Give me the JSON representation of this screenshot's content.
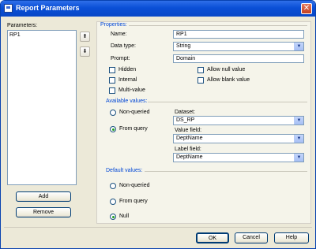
{
  "window": {
    "title": "Report Parameters",
    "close_glyph": "✕"
  },
  "parameters": {
    "label": "Parameters:",
    "items": [
      "RP1"
    ],
    "up_glyph": "⬆",
    "down_glyph": "⬇",
    "add_label": "Add",
    "remove_label": "Remove"
  },
  "properties": {
    "section_label": "Properties:",
    "name_label": "Name:",
    "name_value": "RP1",
    "datatype_label": "Data type:",
    "datatype_value": "String",
    "prompt_label": "Prompt:",
    "prompt_value": "Domain",
    "hidden_label": "Hidden",
    "internal_label": "Internal",
    "multivalue_label": "Multi-value",
    "allow_null_label": "Allow null value",
    "allow_blank_label": "Allow blank value"
  },
  "available_values": {
    "section_label": "Available values:",
    "nonqueried_label": "Non-queried",
    "fromquery_label": "From query",
    "selected": "fromquery",
    "dataset_label": "Dataset:",
    "dataset_value": "DS_RP",
    "valuefield_label": "Value field:",
    "valuefield_value": "DeptName",
    "labelfield_label": "Label field:",
    "labelfield_value": "DeptName"
  },
  "default_values": {
    "section_label": "Default values:",
    "nonqueried_label": "Non-queried",
    "fromquery_label": "From query",
    "null_label": "Null",
    "selected": "null"
  },
  "footer": {
    "ok_label": "OK",
    "cancel_label": "Cancel",
    "help_label": "Help"
  },
  "icons": {
    "dropdown": "▼"
  },
  "colors": {
    "titlebar": "#0a4fd6",
    "section_text": "#0046d5",
    "dialog_bg": "#ece9d8"
  }
}
